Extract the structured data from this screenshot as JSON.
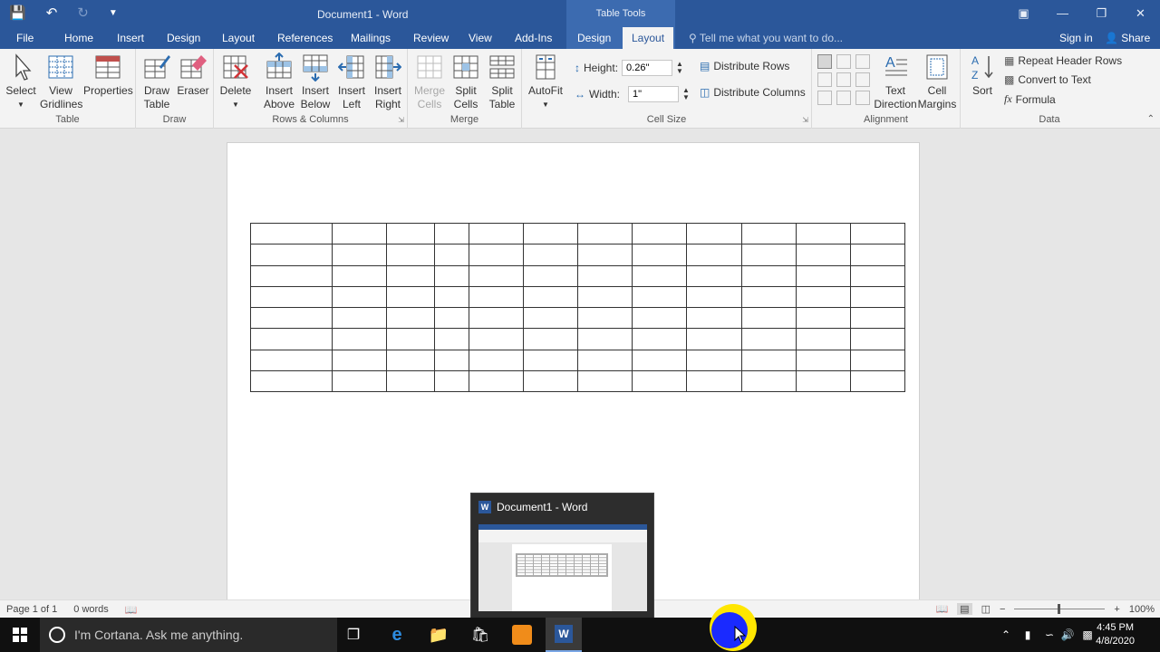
{
  "titlebar": {
    "doc_title": "Document1 - Word",
    "context_label": "Table Tools"
  },
  "tabs": [
    {
      "label": "File"
    },
    {
      "label": "Home"
    },
    {
      "label": "Insert"
    },
    {
      "label": "Design"
    },
    {
      "label": "Layout"
    },
    {
      "label": "References"
    },
    {
      "label": "Mailings"
    },
    {
      "label": "Review"
    },
    {
      "label": "View"
    },
    {
      "label": "Add-Ins"
    },
    {
      "label": "Design"
    },
    {
      "label": "Layout"
    }
  ],
  "tell_me": "Tell me what you want to do...",
  "sign_in": "Sign in",
  "share": "Share",
  "ribbon": {
    "table_group": {
      "label": "Table",
      "select": "Select",
      "view_gridlines_1": "View",
      "view_gridlines_2": "Gridlines",
      "properties": "Properties"
    },
    "draw_group": {
      "label": "Draw",
      "draw_table_1": "Draw",
      "draw_table_2": "Table",
      "eraser": "Eraser"
    },
    "rows_group": {
      "label": "Rows & Columns",
      "delete": "Delete",
      "insert_above_1": "Insert",
      "insert_above_2": "Above",
      "insert_below_1": "Insert",
      "insert_below_2": "Below",
      "insert_left_1": "Insert",
      "insert_left_2": "Left",
      "insert_right_1": "Insert",
      "insert_right_2": "Right"
    },
    "merge_group": {
      "label": "Merge",
      "merge_cells_1": "Merge",
      "merge_cells_2": "Cells",
      "split_cells_1": "Split",
      "split_cells_2": "Cells",
      "split_table_1": "Split",
      "split_table_2": "Table"
    },
    "cellsize_group": {
      "label": "Cell Size",
      "autofit": "AutoFit",
      "height_label": "Height:",
      "height_value": "0.26\"",
      "width_label": "Width:",
      "width_value": "1\"",
      "distribute_rows": "Distribute Rows",
      "distribute_columns": "Distribute Columns"
    },
    "alignment_group": {
      "label": "Alignment",
      "text_direction_1": "Text",
      "text_direction_2": "Direction",
      "cell_margins_1": "Cell",
      "cell_margins_2": "Margins"
    },
    "data_group": {
      "label": "Data",
      "sort": "Sort",
      "repeat_header": "Repeat Header Rows",
      "convert_to_text": "Convert to Text",
      "formula": "Formula"
    }
  },
  "table": {
    "rows": 8,
    "columns": 12
  },
  "status": {
    "page": "Page 1 of 1",
    "words": "0 words",
    "zoom": "100%"
  },
  "thumbnail": {
    "title": "Document1 - Word",
    "word_icon_letter": "W"
  },
  "taskbar": {
    "cortana_placeholder": "I'm Cortana. Ask me anything.",
    "time": "4:45 PM",
    "date": "4/8/2020"
  },
  "colors": {
    "word_blue": "#2b579a",
    "ribbon_bg": "#f3f3f3",
    "taskbar_bg": "#101010"
  }
}
